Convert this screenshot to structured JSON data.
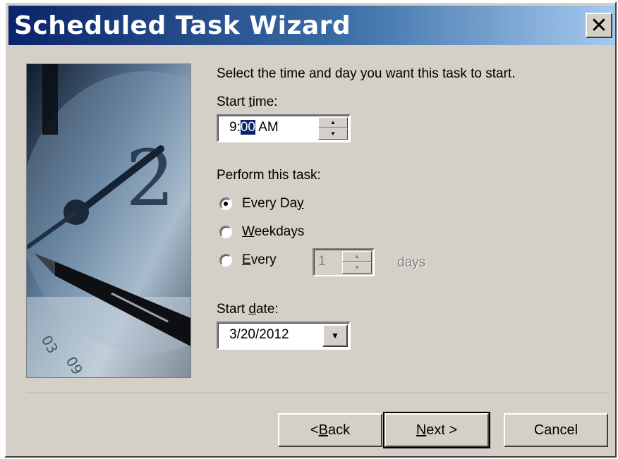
{
  "window": {
    "title": "Scheduled Task Wizard",
    "close_label": "✕"
  },
  "wizard": {
    "instruction": "Select the time and day you want this task to start.",
    "start_time": {
      "label_pre": "Start ",
      "label_u": "t",
      "label_post": "ime:",
      "hour": "9:",
      "minute_selected": "00",
      "suffix": " AM"
    },
    "perform": {
      "label": "Perform this task:",
      "options": [
        {
          "pre": "Every Da",
          "u": "y",
          "post": "",
          "checked": true
        },
        {
          "pre": "",
          "u": "W",
          "post": "eekdays",
          "checked": false
        },
        {
          "pre": "",
          "u": "E",
          "post": "very",
          "checked": false
        }
      ],
      "every_value": "1",
      "every_unit": "days"
    },
    "start_date": {
      "label_pre": "Start ",
      "label_u": "d",
      "label_post": "ate:",
      "value": "3/20/2012"
    }
  },
  "buttons": {
    "back": {
      "pre": "< ",
      "u": "B",
      "post": "ack"
    },
    "next": {
      "pre": "",
      "u": "N",
      "post": "ext >"
    },
    "cancel": "Cancel"
  },
  "icons": {
    "spin_up": "▲",
    "spin_down": "▼",
    "dropdown": "▼"
  }
}
